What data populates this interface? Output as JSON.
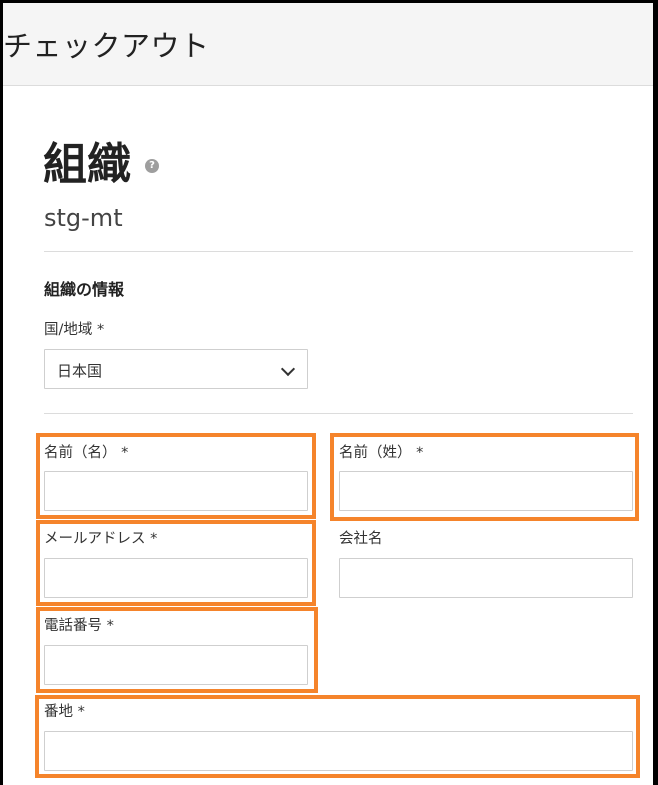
{
  "header": {
    "title": "チェックアウト"
  },
  "page": {
    "title": "組織",
    "help_icon": "?",
    "subtitle": "stg-mt"
  },
  "org_info": {
    "heading": "組織の情報",
    "country_label": "国/地域 *",
    "country_value": "日本国"
  },
  "form": {
    "first_name_label": "名前（名） *",
    "last_name_label": "名前（姓） *",
    "email_label": "メールアドレス *",
    "company_label": "会社名",
    "phone_label": "電話番号 *",
    "address_label": "番地 *"
  },
  "highlight_color": "#f5842b"
}
